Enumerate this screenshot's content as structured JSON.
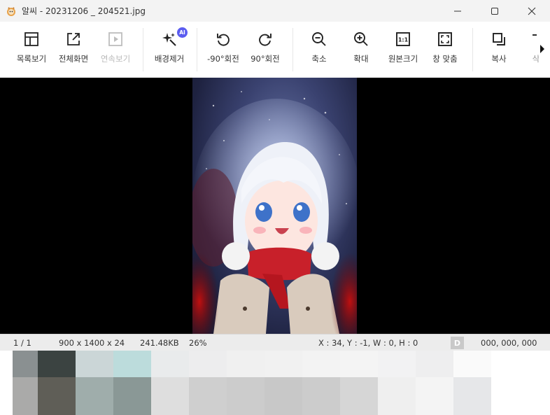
{
  "window": {
    "title": "알씨 - 20231206 _ 204521.jpg",
    "icons": [
      "app-icon",
      "minimize-icon",
      "maximize-icon",
      "close-icon"
    ]
  },
  "toolbar": {
    "list_view": "목록보기",
    "fullscreen": "전체화면",
    "slideshow": "연속보기",
    "remove_bg": "배경제거",
    "ai_badge": "AI",
    "rotate_left": "-90°회전",
    "rotate_right": "90°회전",
    "zoom_out": "축소",
    "zoom_in": "확대",
    "original_size": "원본크기",
    "original_icon_text": "1:1",
    "fit_window": "창 맞춤",
    "copy": "복사",
    "partial": "삭"
  },
  "status": {
    "page": "1 / 1",
    "dimensions": "900 x 1400 x 24",
    "filesize": "241.48KB",
    "zoom": "26%",
    "selection": "X : 34, Y : -1, W : 0, H : 0",
    "badge": "D",
    "rgb": "000, 000, 000"
  },
  "palette_colors": [
    "#8a9091",
    "#3b4341",
    "#cbd6d7",
    "#bcdcdc",
    "#e9ebec",
    "#ededee",
    "#f0f0f0",
    "#f1f1f1",
    "#f3f3f3",
    "#f4f4f4",
    "#f2f2f3",
    "#eeeeef",
    "#fafafa",
    "#aaaaa9",
    "#5f5e57",
    "#9fadab",
    "#8a9896",
    "#dedede",
    "#cfcfcf",
    "#cccccc",
    "#c8c8c8",
    "#cccccc",
    "#d6d6d6",
    "#efefef",
    "#f4f4f4",
    "#e6e7e9"
  ]
}
